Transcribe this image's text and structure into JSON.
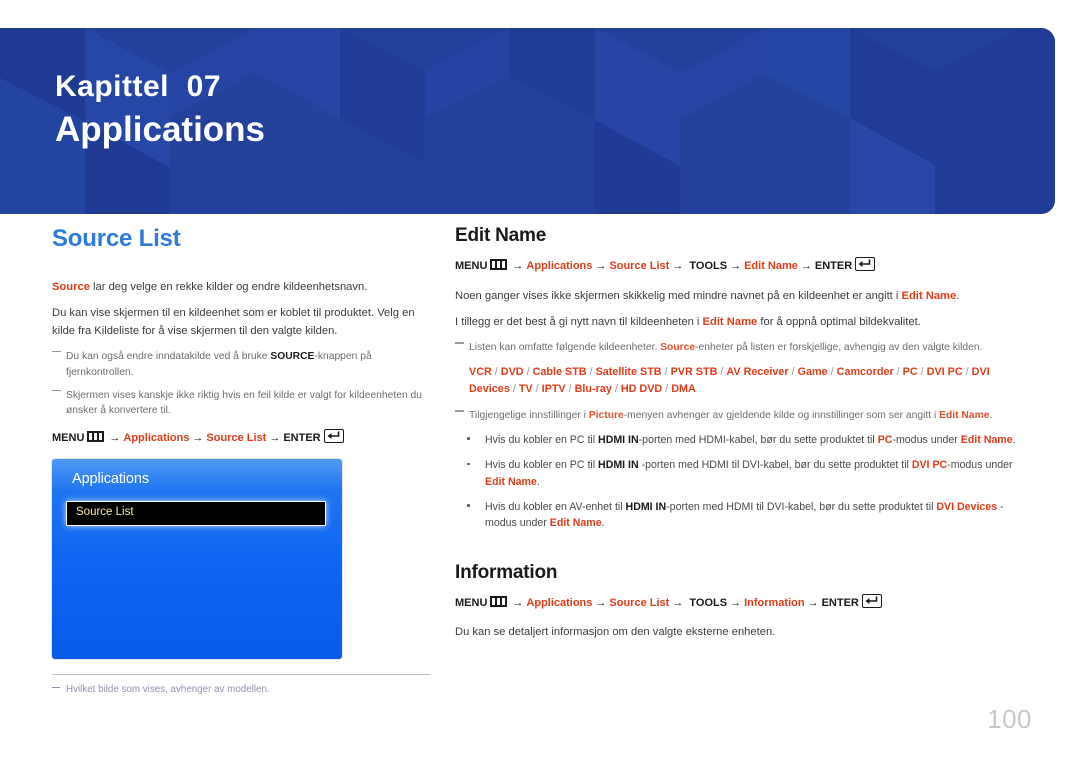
{
  "banner": {
    "chapter": "Kapittel  07",
    "title": "Applications",
    "bg_color": "#23409b"
  },
  "left_column": {
    "heading": "Source List",
    "heading_color": "#2e7bdc",
    "intro_bold": "Source",
    "intro_rest": " lar deg velge en rekke kilder og endre kildeenhetsnavn.",
    "paragraph2": "Du kan vise skjermen til en kildeenhet som er koblet til produktet. Velg en kilde fra Kildeliste for å vise skjermen til den valgte kilden.",
    "notes": [
      {
        "pre": "Du kan også endre inndatakilde ved å bruke ",
        "bold": "SOURCE",
        "post": "-knappen på fjernkontrollen."
      },
      {
        "pre": "Skjermen vises kanskje ikke riktig hvis en feil kilde er valgt for kildeenheten du ønsker å konvertere til.",
        "bold": "",
        "post": ""
      }
    ],
    "path": {
      "menu_label": "MENU",
      "menu_icon": "menu-bars-icon",
      "steps": [
        "Applications",
        "Source List"
      ],
      "enter_label": "ENTER",
      "enter_icon": "enter-return-icon",
      "arrow": "→"
    },
    "osd": {
      "title": "Applications",
      "selected_item": "Source List"
    },
    "footnote": "Hvilket bilde som vises, avhenger av modellen."
  },
  "right_column": {
    "edit_name": {
      "heading": "Edit Name",
      "path": {
        "menu_label": "MENU",
        "steps_red": [
          "Applications",
          "Source List"
        ],
        "tools_label": "TOOLS",
        "final_red": "Edit Name",
        "enter_label": "ENTER",
        "arrow": "→"
      },
      "para1_pre": "Noen ganger vises ikke skjermen skikkelig med mindre navnet på en kildeenhet er angitt i ",
      "para1_red": "Edit Name",
      "para1_post": ".",
      "para2_pre": "I tillegg er det best å gi nytt navn til kildeenheten i ",
      "para2_red": "Edit Name",
      "para2_post": " for å oppnå optimal bildekvalitet.",
      "note1_pre": "Listen kan omfatte følgende kildeenheter. ",
      "note1_red": "Source",
      "note1_post": "-enheter på listen er forskjellige, avhengig av den valgte kilden.",
      "devices": [
        "VCR",
        "DVD",
        "Cable STB",
        "Satellite STB",
        "PVR STB",
        "AV Receiver",
        "Game",
        "Camcorder",
        "PC",
        "DVI PC",
        "DVI Devices",
        "TV",
        "IPTV",
        "Blu-ray",
        "HD DVD",
        "DMA"
      ],
      "device_separator": "/",
      "note2_pre": "Tilgjengelige innstillinger i ",
      "note2_red1": "Picture",
      "note2_mid": "-menyen avhenger av gjeldende kilde og innstillinger som ser angitt i ",
      "note2_red2": "Edit Name",
      "note2_post": ".",
      "bullets": [
        {
          "t1": "Hvis du kobler en PC til ",
          "b1": "HDMI IN",
          "t2": "-porten med HDMI-kabel, bør du sette produktet til ",
          "r1": "PC",
          "t3": "-modus under ",
          "r2": "Edit Name",
          "t4": "."
        },
        {
          "t1": "Hvis du kobler en PC til ",
          "b1": "HDMI IN",
          "t2": " -porten med HDMI til DVI-kabel, bør du sette produktet til ",
          "r1": "DVI PC",
          "t3": "-modus under ",
          "r2": "Edit Name",
          "t4": "."
        },
        {
          "t1": "Hvis du kobler en AV-enhet til ",
          "b1": "HDMI IN",
          "t2": "-porten med HDMI til DVI-kabel, bør du sette produktet til ",
          "r1": "DVI Devices",
          "t3": " -modus under ",
          "r2": "Edit Name",
          "t4": "."
        }
      ]
    },
    "information": {
      "heading": "Information",
      "path": {
        "menu_label": "MENU",
        "steps_red": [
          "Applications",
          "Source List"
        ],
        "tools_label": "TOOLS",
        "final_red": "Information",
        "enter_label": "ENTER",
        "arrow": "→"
      },
      "paragraph": "Du kan se detaljert informasjon om den valgte eksterne enheten."
    }
  },
  "page_number": "100",
  "colors": {
    "accent_red": "#e03c18",
    "heading_blue": "#2e7bdc",
    "banner_blue": "#23409b"
  }
}
